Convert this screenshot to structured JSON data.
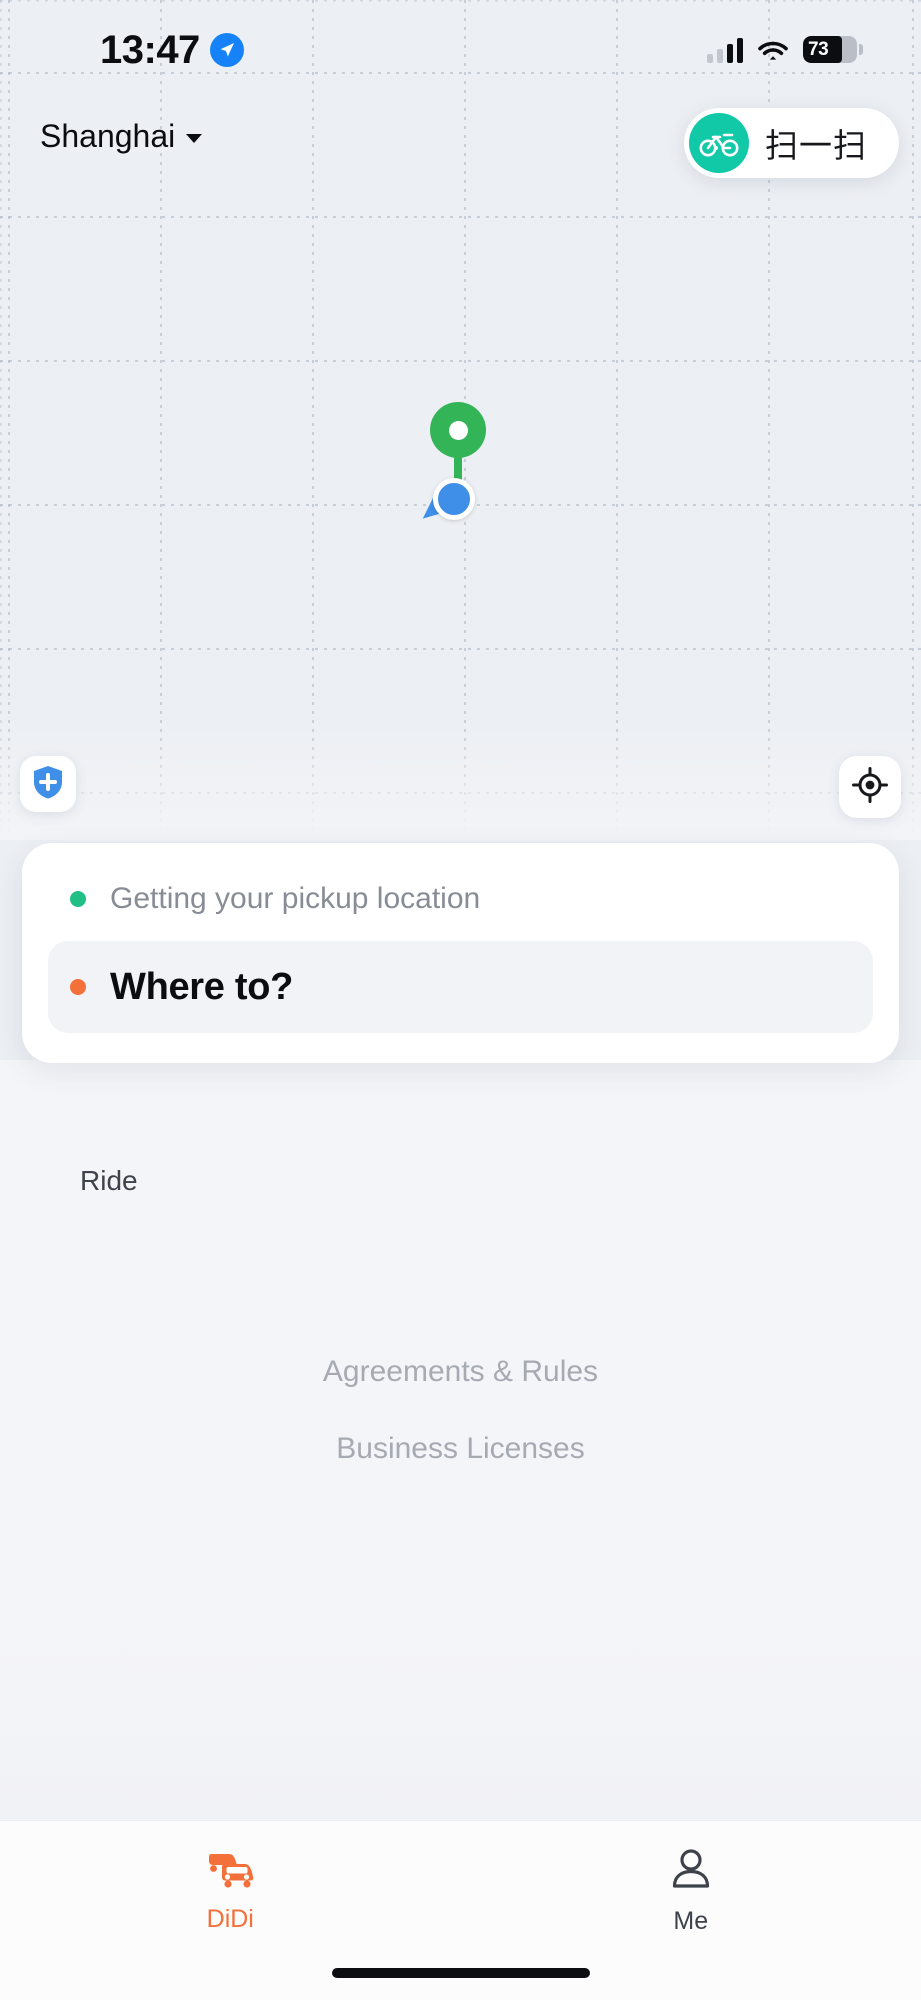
{
  "status_bar": {
    "time": "13:47",
    "location_arrow_icon": "location-arrow-icon",
    "cellular_icon": "cellular-signal-icon",
    "wifi_icon": "wifi-icon",
    "battery_icon": "battery-icon",
    "battery_percent": "73",
    "battery_level": 73
  },
  "header": {
    "city": "Shanghai",
    "city_caret_icon": "chevron-down-icon",
    "scan_label": "扫一扫",
    "scan_icon": "bicycle-icon"
  },
  "map": {
    "pin_icon": "destination-pin-icon",
    "user_location_icon": "user-location-dot-icon",
    "safety_button_icon": "shield-plus-icon",
    "locate_button_icon": "crosshair-locate-icon"
  },
  "search_card": {
    "pickup_status": "Getting your pickup location",
    "pickup_dot_icon": "pickup-dot-icon",
    "destination_placeholder": "Where to?",
    "destination_dot_icon": "destination-dot-icon"
  },
  "sections": {
    "ride_label": "Ride"
  },
  "legal": {
    "links": [
      "Agreements & Rules",
      "Business Licenses"
    ]
  },
  "tabbar": {
    "tabs": [
      {
        "label": "DiDi",
        "icon": "car-icon",
        "active": true
      },
      {
        "label": "Me",
        "icon": "person-icon",
        "active": false
      }
    ]
  },
  "colors": {
    "accent_orange": "#f4703a",
    "scan_teal": "#11c9a6",
    "pin_green": "#33b457",
    "user_blue": "#3f8fe8",
    "pickup_green": "#1fbf86",
    "map_bg": "#eceff3",
    "page_bg": "#f4f5f8"
  }
}
